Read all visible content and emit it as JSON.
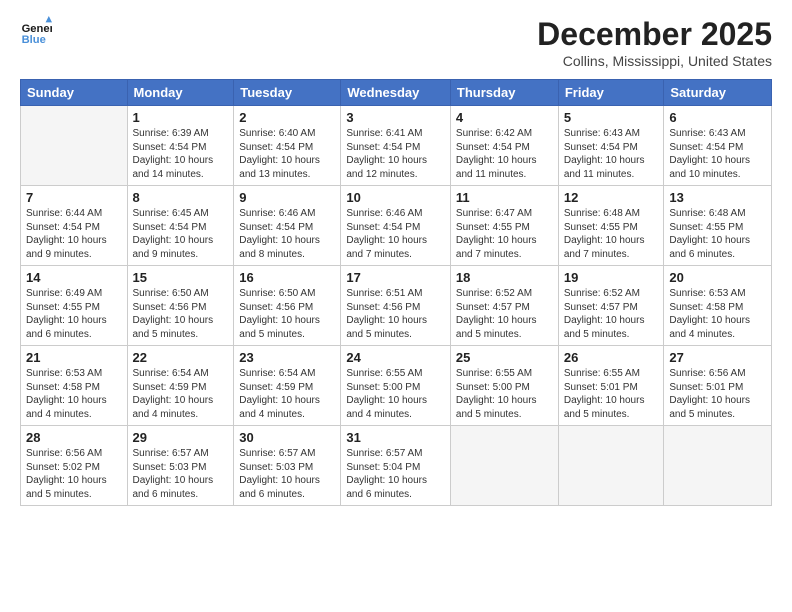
{
  "logo": {
    "line1": "General",
    "line2": "Blue"
  },
  "title": "December 2025",
  "subtitle": "Collins, Mississippi, United States",
  "days_of_week": [
    "Sunday",
    "Monday",
    "Tuesday",
    "Wednesday",
    "Thursday",
    "Friday",
    "Saturday"
  ],
  "weeks": [
    [
      {
        "num": "",
        "info": ""
      },
      {
        "num": "1",
        "info": "Sunrise: 6:39 AM\nSunset: 4:54 PM\nDaylight: 10 hours\nand 14 minutes."
      },
      {
        "num": "2",
        "info": "Sunrise: 6:40 AM\nSunset: 4:54 PM\nDaylight: 10 hours\nand 13 minutes."
      },
      {
        "num": "3",
        "info": "Sunrise: 6:41 AM\nSunset: 4:54 PM\nDaylight: 10 hours\nand 12 minutes."
      },
      {
        "num": "4",
        "info": "Sunrise: 6:42 AM\nSunset: 4:54 PM\nDaylight: 10 hours\nand 11 minutes."
      },
      {
        "num": "5",
        "info": "Sunrise: 6:43 AM\nSunset: 4:54 PM\nDaylight: 10 hours\nand 11 minutes."
      },
      {
        "num": "6",
        "info": "Sunrise: 6:43 AM\nSunset: 4:54 PM\nDaylight: 10 hours\nand 10 minutes."
      }
    ],
    [
      {
        "num": "7",
        "info": "Sunrise: 6:44 AM\nSunset: 4:54 PM\nDaylight: 10 hours\nand 9 minutes."
      },
      {
        "num": "8",
        "info": "Sunrise: 6:45 AM\nSunset: 4:54 PM\nDaylight: 10 hours\nand 9 minutes."
      },
      {
        "num": "9",
        "info": "Sunrise: 6:46 AM\nSunset: 4:54 PM\nDaylight: 10 hours\nand 8 minutes."
      },
      {
        "num": "10",
        "info": "Sunrise: 6:46 AM\nSunset: 4:54 PM\nDaylight: 10 hours\nand 7 minutes."
      },
      {
        "num": "11",
        "info": "Sunrise: 6:47 AM\nSunset: 4:55 PM\nDaylight: 10 hours\nand 7 minutes."
      },
      {
        "num": "12",
        "info": "Sunrise: 6:48 AM\nSunset: 4:55 PM\nDaylight: 10 hours\nand 7 minutes."
      },
      {
        "num": "13",
        "info": "Sunrise: 6:48 AM\nSunset: 4:55 PM\nDaylight: 10 hours\nand 6 minutes."
      }
    ],
    [
      {
        "num": "14",
        "info": "Sunrise: 6:49 AM\nSunset: 4:55 PM\nDaylight: 10 hours\nand 6 minutes."
      },
      {
        "num": "15",
        "info": "Sunrise: 6:50 AM\nSunset: 4:56 PM\nDaylight: 10 hours\nand 5 minutes."
      },
      {
        "num": "16",
        "info": "Sunrise: 6:50 AM\nSunset: 4:56 PM\nDaylight: 10 hours\nand 5 minutes."
      },
      {
        "num": "17",
        "info": "Sunrise: 6:51 AM\nSunset: 4:56 PM\nDaylight: 10 hours\nand 5 minutes."
      },
      {
        "num": "18",
        "info": "Sunrise: 6:52 AM\nSunset: 4:57 PM\nDaylight: 10 hours\nand 5 minutes."
      },
      {
        "num": "19",
        "info": "Sunrise: 6:52 AM\nSunset: 4:57 PM\nDaylight: 10 hours\nand 5 minutes."
      },
      {
        "num": "20",
        "info": "Sunrise: 6:53 AM\nSunset: 4:58 PM\nDaylight: 10 hours\nand 4 minutes."
      }
    ],
    [
      {
        "num": "21",
        "info": "Sunrise: 6:53 AM\nSunset: 4:58 PM\nDaylight: 10 hours\nand 4 minutes."
      },
      {
        "num": "22",
        "info": "Sunrise: 6:54 AM\nSunset: 4:59 PM\nDaylight: 10 hours\nand 4 minutes."
      },
      {
        "num": "23",
        "info": "Sunrise: 6:54 AM\nSunset: 4:59 PM\nDaylight: 10 hours\nand 4 minutes."
      },
      {
        "num": "24",
        "info": "Sunrise: 6:55 AM\nSunset: 5:00 PM\nDaylight: 10 hours\nand 4 minutes."
      },
      {
        "num": "25",
        "info": "Sunrise: 6:55 AM\nSunset: 5:00 PM\nDaylight: 10 hours\nand 5 minutes."
      },
      {
        "num": "26",
        "info": "Sunrise: 6:55 AM\nSunset: 5:01 PM\nDaylight: 10 hours\nand 5 minutes."
      },
      {
        "num": "27",
        "info": "Sunrise: 6:56 AM\nSunset: 5:01 PM\nDaylight: 10 hours\nand 5 minutes."
      }
    ],
    [
      {
        "num": "28",
        "info": "Sunrise: 6:56 AM\nSunset: 5:02 PM\nDaylight: 10 hours\nand 5 minutes."
      },
      {
        "num": "29",
        "info": "Sunrise: 6:57 AM\nSunset: 5:03 PM\nDaylight: 10 hours\nand 6 minutes."
      },
      {
        "num": "30",
        "info": "Sunrise: 6:57 AM\nSunset: 5:03 PM\nDaylight: 10 hours\nand 6 minutes."
      },
      {
        "num": "31",
        "info": "Sunrise: 6:57 AM\nSunset: 5:04 PM\nDaylight: 10 hours\nand 6 minutes."
      },
      {
        "num": "",
        "info": ""
      },
      {
        "num": "",
        "info": ""
      },
      {
        "num": "",
        "info": ""
      }
    ]
  ]
}
